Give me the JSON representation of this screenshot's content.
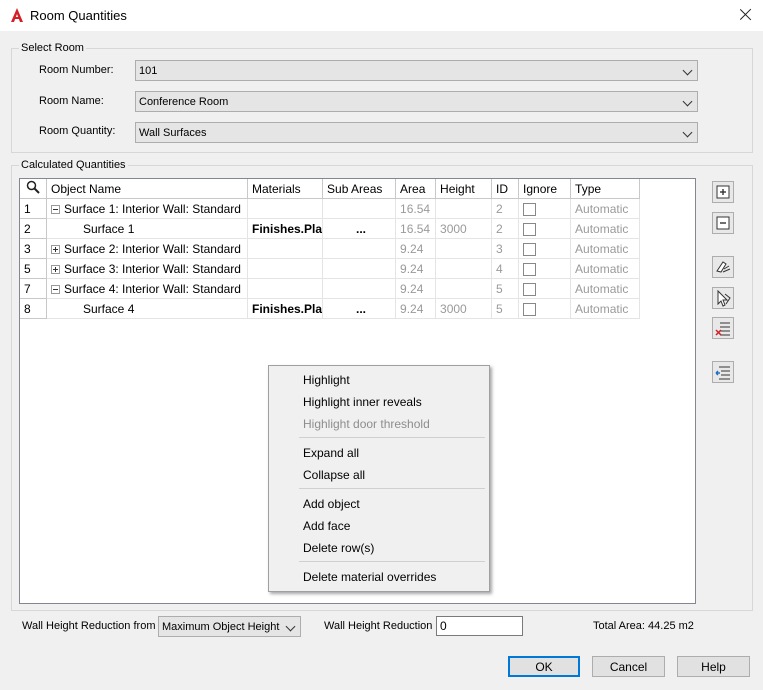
{
  "window": {
    "title": "Room Quantities"
  },
  "select_room": {
    "group_label": "Select Room",
    "room_number_label": "Room Number:",
    "room_number_value": "101",
    "room_name_label": "Room Name:",
    "room_name_value": "Conference Room",
    "room_quantity_label": "Room Quantity:",
    "room_quantity_value": "Wall Surfaces"
  },
  "calculated": {
    "group_label": "Calculated Quantities",
    "columns": [
      "Object Name",
      "Materials",
      "Sub Areas",
      "Area",
      "Height",
      "ID",
      "Ignore",
      "Type"
    ],
    "rows": [
      {
        "num": "1",
        "name": "Surface 1: Interior Wall: Standard",
        "level": 0,
        "expander": "minus",
        "materials": "",
        "sub_areas": "",
        "area": "16.54",
        "height": "",
        "id": "2",
        "type": "Automatic"
      },
      {
        "num": "2",
        "name": "Surface 1",
        "level": 1,
        "expander": "",
        "materials": "Finishes.Pla",
        "sub_areas": "...",
        "area": "16.54",
        "height": "3000",
        "id": "2",
        "type": "Automatic"
      },
      {
        "num": "3",
        "name": "Surface 2: Interior Wall: Standard",
        "level": 0,
        "expander": "plus",
        "materials": "",
        "sub_areas": "",
        "area": "9.24",
        "height": "",
        "id": "3",
        "type": "Automatic"
      },
      {
        "num": "5",
        "name": "Surface 3: Interior Wall: Standard",
        "level": 0,
        "expander": "plus",
        "materials": "",
        "sub_areas": "",
        "area": "9.24",
        "height": "",
        "id": "4",
        "type": "Automatic"
      },
      {
        "num": "7",
        "name": "Surface 4: Interior Wall: Standard",
        "level": 0,
        "expander": "minus",
        "materials": "",
        "sub_areas": "",
        "area": "9.24",
        "height": "",
        "id": "5",
        "type": "Automatic"
      },
      {
        "num": "8",
        "name": "Surface 4",
        "level": 1,
        "expander": "",
        "materials": "Finishes.Pla",
        "sub_areas": "...",
        "area": "9.24",
        "height": "3000",
        "id": "5",
        "type": "Automatic"
      }
    ]
  },
  "context_menu": {
    "items": [
      "Highlight",
      "Highlight inner reveals",
      "Highlight door threshold",
      "Expand all",
      "Collapse all",
      "Add object",
      "Add face",
      "Delete row(s)",
      "Delete material overrides"
    ],
    "disabled": [
      "Highlight door threshold"
    ]
  },
  "bottom": {
    "wall_height_reduction_from_label": "Wall Height Reduction from",
    "wall_height_reduction_from_value": "Maximum Object Height",
    "wall_height_reduction_label": "Wall Height Reduction",
    "wall_height_reduction_value": "0",
    "total_area": "Total Area: 44.25 m2"
  },
  "buttons": {
    "ok": "OK",
    "cancel": "Cancel",
    "help": "Help"
  },
  "icons": {
    "app": "autocad-icon",
    "close": "close-icon",
    "search": "search-icon",
    "side_tools": [
      "expand-all-icon",
      "collapse-all-icon",
      "highlight-icon",
      "select-object-icon",
      "delete-rows-icon",
      "delete-material-override-icon"
    ]
  },
  "colors": {
    "accent": "#0078d7",
    "app_icon": "#d32027"
  }
}
